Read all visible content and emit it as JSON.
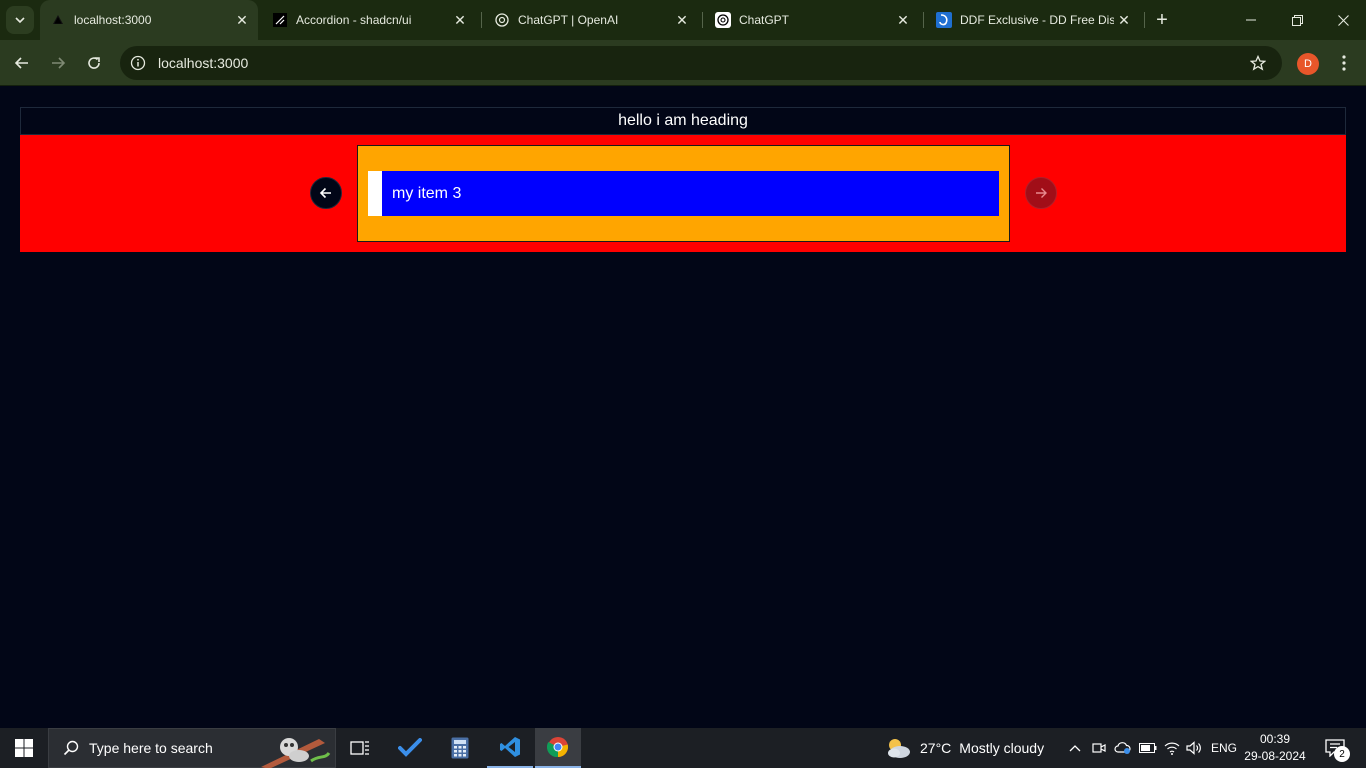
{
  "browser": {
    "tabs": [
      {
        "title": "localhost:3000",
        "favicon": "vercel-triangle-icon",
        "active": true
      },
      {
        "title": "Accordion - shadcn/ui",
        "favicon": "shadcn-icon",
        "active": false
      },
      {
        "title": "ChatGPT | OpenAI",
        "favicon": "openai-icon",
        "active": false
      },
      {
        "title": "ChatGPT",
        "favicon": "openai-icon",
        "active": false
      },
      {
        "title": "DDF Exclusive - DD Free Dish",
        "favicon": "ddf-icon",
        "active": false
      }
    ],
    "new_tab_symbol": "+",
    "address": "localhost:3000",
    "profile_initial": "D",
    "colors": {
      "frame": "#1b2a10",
      "toolbar": "#2b3b20",
      "profile": "#e8562a"
    }
  },
  "page": {
    "heading": "hello i am heading",
    "carousel": {
      "current_item": "my item 3",
      "prev_icon": "arrow-left-icon",
      "next_icon": "arrow-right-icon",
      "colors": {
        "band": "#ff0000",
        "frame": "#ffa500",
        "slide": "#0000ff"
      }
    },
    "background": "#020617"
  },
  "taskbar": {
    "search_placeholder": "Type here to search",
    "weather": {
      "temperature": "27°C",
      "condition": "Mostly cloudy"
    },
    "language": "ENG",
    "time": "00:39",
    "date": "29-08-2024",
    "notification_count": "2",
    "pinned_icons": [
      "task-view-icon",
      "todo-icon",
      "calculator-icon",
      "vscode-icon",
      "chrome-icon"
    ]
  }
}
